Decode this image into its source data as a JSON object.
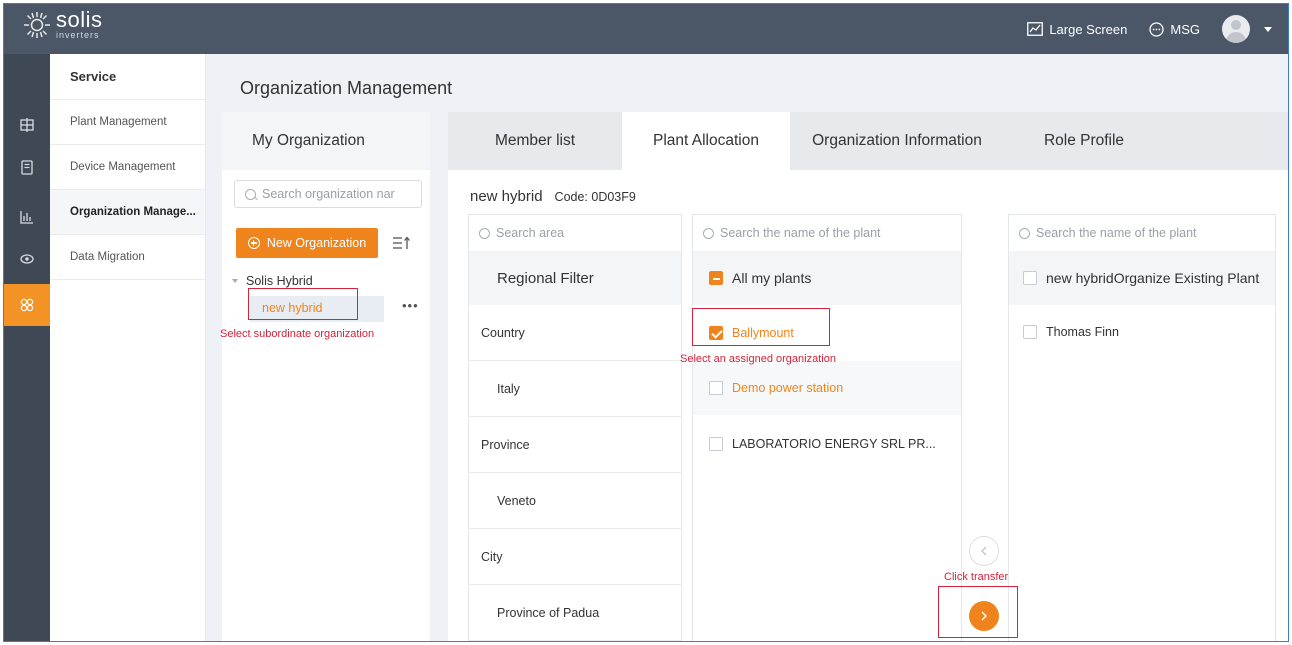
{
  "header": {
    "logo_text": "solis",
    "logo_subtext": "inverters",
    "large_screen": "Large Screen",
    "msg": "MSG"
  },
  "colors": {
    "accent": "#f0841c",
    "topbar": "#4b5666",
    "annotation": "#d6213a"
  },
  "rail": {
    "items": [
      {
        "icon": "plant-grid-icon"
      },
      {
        "icon": "device-icon"
      },
      {
        "icon": "chart-icon"
      },
      {
        "icon": "eye-icon"
      },
      {
        "icon": "service-icon",
        "active": true
      }
    ]
  },
  "menu": {
    "title": "Service",
    "items": [
      {
        "label": "Plant Management"
      },
      {
        "label": "Device Management"
      },
      {
        "label": "Organization Manage...",
        "active": true
      },
      {
        "label": "Data Migration"
      }
    ]
  },
  "page": {
    "title": "Organization Management"
  },
  "org_panel": {
    "title": "My Organization",
    "search_placeholder": "Search organization nar",
    "new_button": "New Organization",
    "tree": {
      "root": "Solis Hybrid",
      "child": "new hybrid"
    }
  },
  "tabs": [
    "Member list",
    "Plant Allocation",
    "Organization Information",
    "Role Profile"
  ],
  "org_info": {
    "name": "new hybrid",
    "code": "Code: 0D03F9"
  },
  "region": {
    "search_placeholder": "Search area",
    "title": "Regional Filter",
    "rows": [
      {
        "type": "cat",
        "label": "Country"
      },
      {
        "type": "val",
        "label": "Italy"
      },
      {
        "type": "cat",
        "label": "Province"
      },
      {
        "type": "val",
        "label": "Veneto"
      },
      {
        "type": "cat",
        "label": "City"
      },
      {
        "type": "val",
        "label": "Province of Padua"
      }
    ]
  },
  "plants": {
    "search_placeholder": "Search the name of the plant",
    "all_label": "All my plants",
    "items": [
      "Ballymount",
      "Demo power station",
      "LABORATORIO ENERGY SRL PR..."
    ]
  },
  "target": {
    "search_placeholder": "Search the name of the plant",
    "header_label": "new hybridOrganize Existing Plant",
    "items": [
      "Thomas Finn"
    ]
  },
  "annotations": {
    "subordinate": "Select subordinate organization",
    "assigned": "Select an assigned organization",
    "transfer": "Click transfer"
  }
}
